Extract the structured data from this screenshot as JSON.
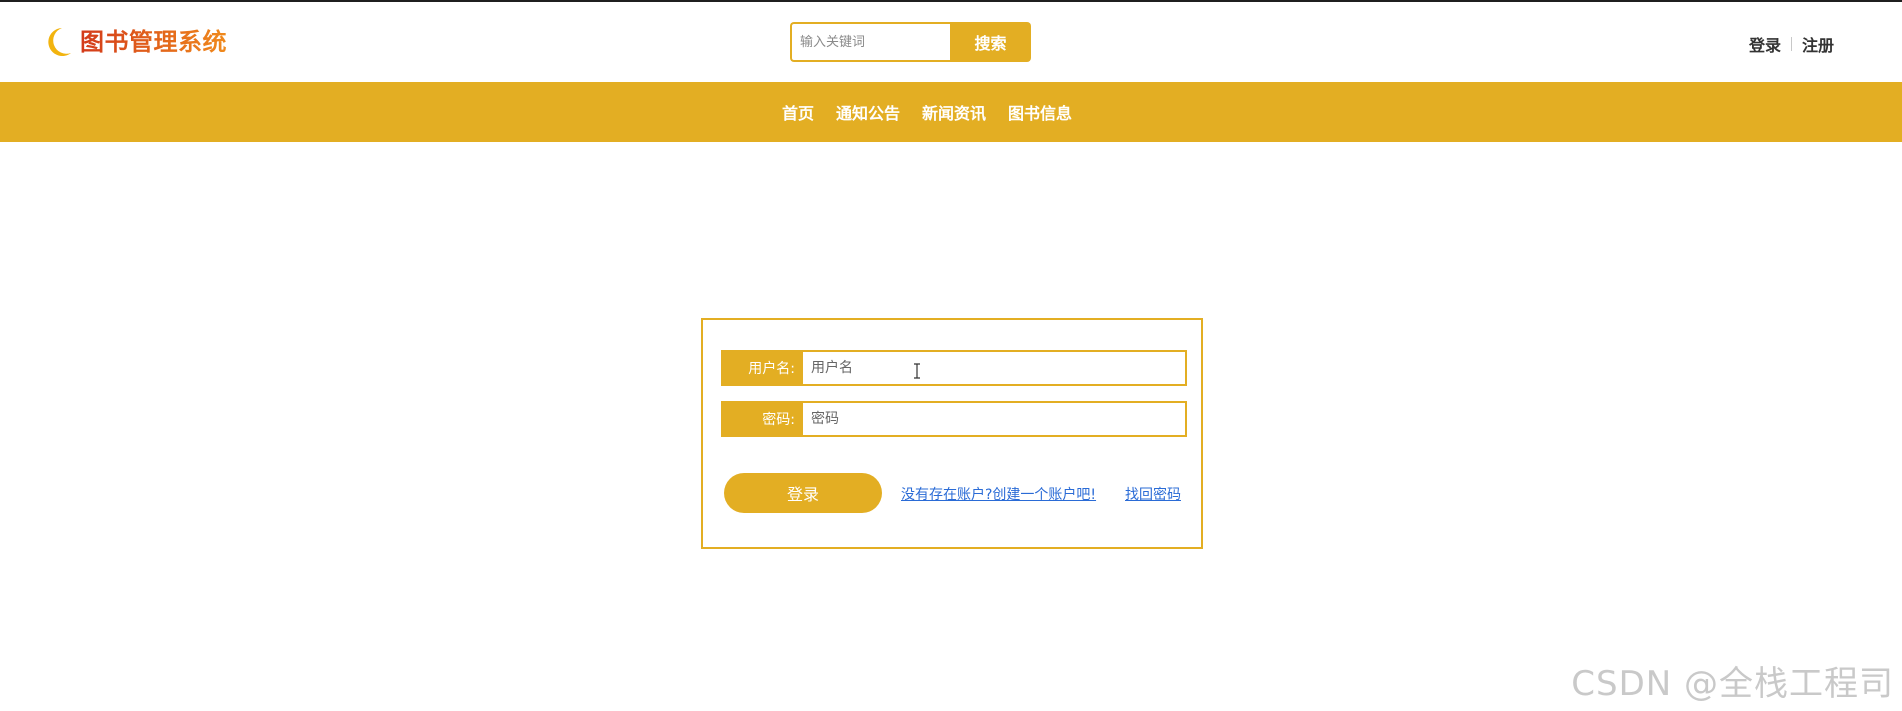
{
  "app": {
    "title": "图书管理系统",
    "icon": "moon-icon",
    "accent_color": "#e3ae23"
  },
  "search": {
    "placeholder": "输入关键词",
    "button_label": "搜索"
  },
  "auth": {
    "login_label": "登录",
    "register_label": "注册"
  },
  "nav": {
    "items": [
      {
        "label": "首页"
      },
      {
        "label": "通知公告"
      },
      {
        "label": "新闻资讯"
      },
      {
        "label": "图书信息"
      }
    ]
  },
  "login_form": {
    "username_label": "用户名:",
    "username_placeholder": "用户名",
    "password_label": "密码:",
    "password_placeholder": "密码",
    "submit_label": "登录",
    "register_link": "没有存在账户?创建一个账户吧!",
    "forgot_link": "找回密码",
    "link_color": "#2a6bd6"
  },
  "watermark": "CSDN @全栈工程司"
}
